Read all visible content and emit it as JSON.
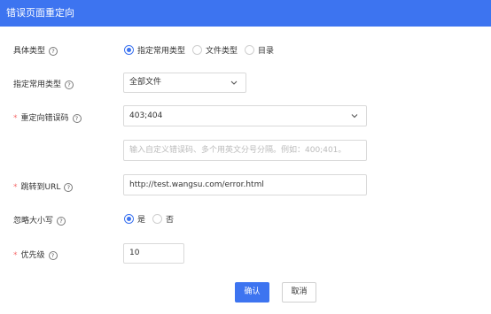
{
  "header": {
    "title": "错误页面重定向"
  },
  "fields": {
    "specific_type": {
      "label": "具体类型",
      "options": [
        {
          "label": "指定常用类型",
          "checked": true
        },
        {
          "label": "文件类型",
          "checked": false
        },
        {
          "label": "目录",
          "checked": false
        }
      ]
    },
    "common_type": {
      "label": "指定常用类型",
      "value": "全部文件"
    },
    "redirect_codes": {
      "label": "重定向错误码",
      "value": "403;404",
      "custom_placeholder": "输入自定义错误码、多个用英文分号分隔。例如：400;401。"
    },
    "redirect_url": {
      "label": "跳转到URL",
      "value": "http://test.wangsu.com/error.html"
    },
    "ignore_case": {
      "label": "忽略大小写",
      "options": [
        {
          "label": "是",
          "checked": true
        },
        {
          "label": "否",
          "checked": false
        }
      ]
    },
    "priority": {
      "label": "优先级",
      "value": "10"
    }
  },
  "icons": {
    "help": "?"
  },
  "buttons": {
    "confirm": "确认",
    "cancel": "取消"
  },
  "colors": {
    "primary": "#3d74f0",
    "required": "#f56c6c"
  }
}
